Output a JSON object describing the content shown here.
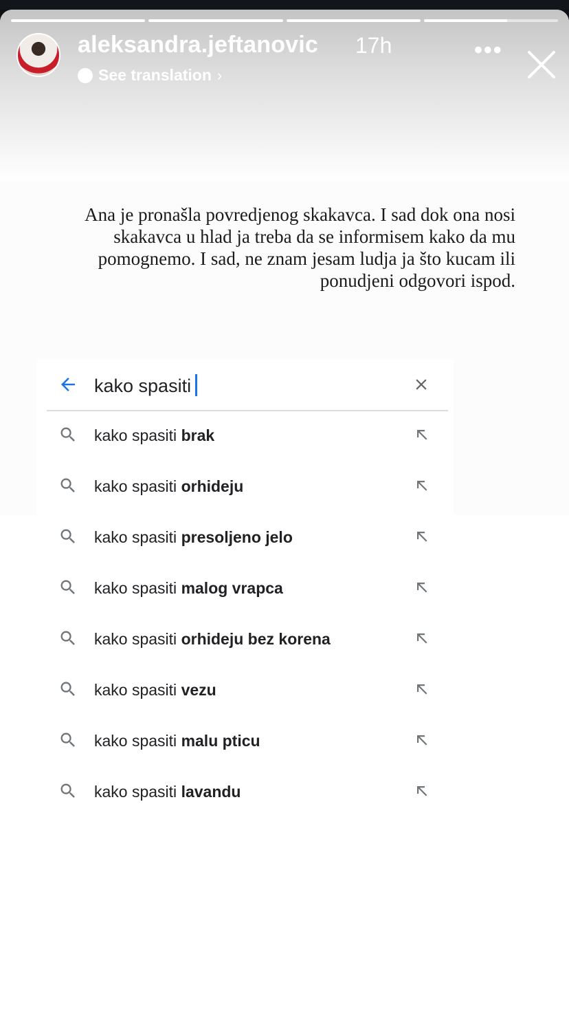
{
  "story": {
    "username": "aleksandra.jeftanovic",
    "time": "17h",
    "translation_label": "See translation",
    "progress": [
      1,
      1,
      1,
      0.62,
      0
    ],
    "caption_lines": [
      "Ana je pronašla povredjenog skakavca. I sad dok ona nosi",
      "skakavca u hlad ja treba da se informisem kako da mu",
      "pomognemo. I sad, ne znam jesam ludja ja  što kucam ili",
      "ponudjeni odgovori ispod."
    ]
  },
  "search": {
    "query": "kako spasiti",
    "suggestions": [
      {
        "prefix": "kako spasiti",
        "completion": "brak"
      },
      {
        "prefix": "kako spasiti",
        "completion": "orhideju"
      },
      {
        "prefix": "kako spasiti",
        "completion": "presoljeno jelo"
      },
      {
        "prefix": "kako spasiti",
        "completion": "malog vrapca"
      },
      {
        "prefix": "kako spasiti",
        "completion": "orhideju bez korena"
      },
      {
        "prefix": "kako spasiti",
        "completion": "vezu"
      },
      {
        "prefix": "kako spasiti",
        "completion": "malu pticu"
      },
      {
        "prefix": "kako spasiti",
        "completion": "lavandu"
      }
    ]
  },
  "icons": {
    "back": "arrow-left-icon",
    "clear": "close-icon",
    "suggestion": "search-icon",
    "fill": "arrow-up-left-icon",
    "more": "more-horizontal-icon",
    "close_story": "close-icon"
  },
  "colors": {
    "accent": "#1a73e8",
    "text": "#202124",
    "icon_gray": "#70757a"
  }
}
